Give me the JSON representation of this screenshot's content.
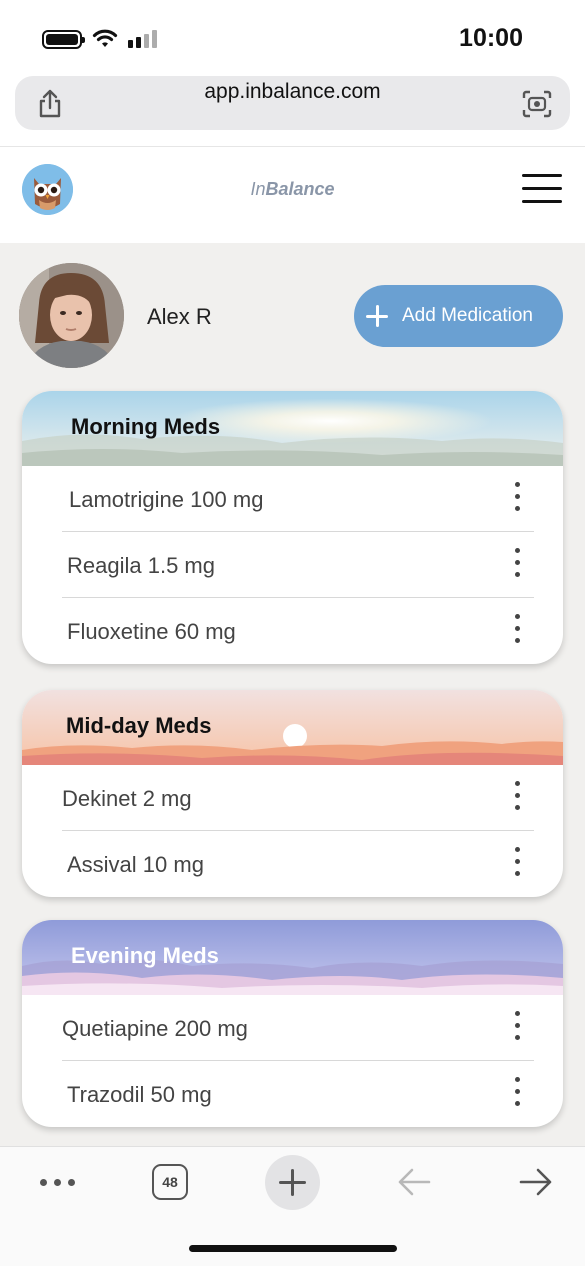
{
  "status_bar": {
    "time": "10:00"
  },
  "browser": {
    "url": "app.inbalance.com",
    "tab_count": "48"
  },
  "app": {
    "brand_prefix": "In",
    "brand_suffix": "Balance"
  },
  "user": {
    "name": "Alex R"
  },
  "actions": {
    "add_medication": "Add Medication"
  },
  "cards": [
    {
      "title": "Morning Meds",
      "meds": [
        "Lamotrigine 100 mg",
        "Reagila 1.5 mg",
        "Fluoxetine 60 mg"
      ]
    },
    {
      "title": "Mid-day Meds",
      "meds": [
        "Dekinet 2 mg",
        "Assival 10 mg"
      ]
    },
    {
      "title": "Evening Meds",
      "meds": [
        "Quetiapine 200 mg",
        "Trazodil 50 mg"
      ]
    }
  ],
  "colors": {
    "accent": "#6aa0d2",
    "brand_text": "#8a96a8",
    "background": "#f1f0ee"
  },
  "icons": [
    "battery-icon",
    "wifi-icon",
    "signal-icon",
    "share-icon",
    "camera-lens-icon",
    "owl-logo-icon",
    "hamburger-menu-icon",
    "plus-icon",
    "more-vertical-icon",
    "ellipsis-icon",
    "tabs-icon",
    "new-tab-icon",
    "back-arrow-icon",
    "forward-arrow-icon"
  ]
}
